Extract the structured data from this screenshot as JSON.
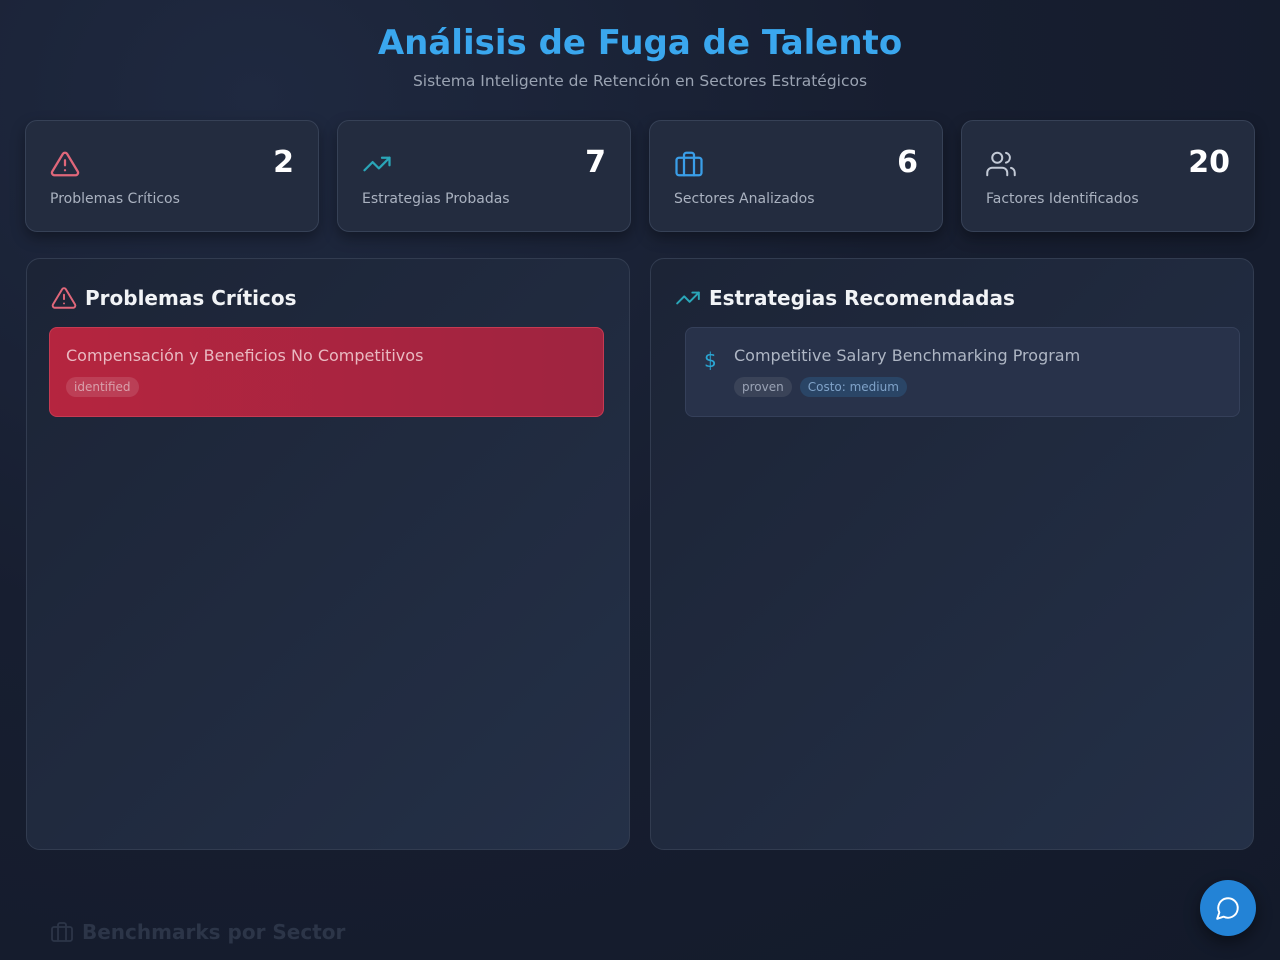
{
  "header": {
    "title": "Análisis de Fuga de Talento",
    "subtitle": "Sistema Inteligente de Retención en Sectores Estratégicos"
  },
  "stats": [
    {
      "icon": "alert-triangle-icon",
      "value": "2",
      "label": "Problemas Críticos",
      "color": "#e0677a"
    },
    {
      "icon": "trending-up-icon",
      "value": "7",
      "label": "Estrategias Probadas",
      "color": "#2aa6b8"
    },
    {
      "icon": "briefcase-icon",
      "value": "6",
      "label": "Sectores Analizados",
      "color": "#3a9ee8"
    },
    {
      "icon": "users-icon",
      "value": "20",
      "label": "Factores Identificados",
      "color": "#c3cad6"
    }
  ],
  "problems_panel": {
    "title": "Problemas Críticos",
    "icon": "alert-triangle-icon",
    "items": [
      {
        "title": "Compensación y Beneficios No Competitivos",
        "status": "identified"
      }
    ]
  },
  "strategies_panel": {
    "title": "Estrategias Recomendadas",
    "icon": "trending-up-icon",
    "items": [
      {
        "icon": "dollar-icon",
        "title": "Competitive Salary Benchmarking Program",
        "evidence": "proven",
        "cost": "Costo: medium"
      }
    ]
  },
  "benchmarks_section": {
    "title": "Benchmarks por Sector",
    "icon": "briefcase-icon"
  },
  "chat_button": {
    "icon": "message-circle-icon"
  },
  "colors": {
    "accent": "#3aa7ee",
    "critical": "#b5253f",
    "fab": "#2383d6"
  }
}
